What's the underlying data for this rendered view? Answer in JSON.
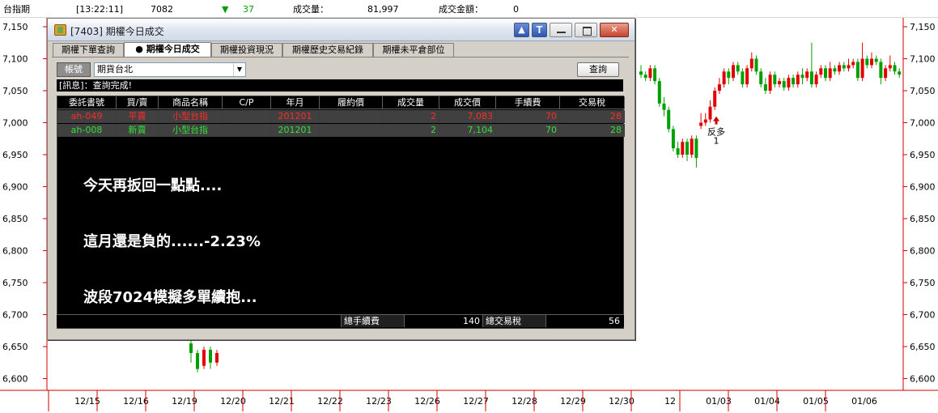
{
  "topbar": {
    "symbol": "台指期",
    "time": "[13:22:11]",
    "price": "7082",
    "change_arrow": "▼",
    "change": "37",
    "volume_label": "成交量：",
    "volume": "81,997",
    "amount_label": "成交金額：",
    "amount": "0",
    "down_color": "#00a000"
  },
  "window": {
    "title": "[7403] 期權今日成交",
    "tabs": [
      "期權下單查詢",
      "● 期權今日成交",
      "期權投資現況",
      "期權歷史交易紀錄",
      "期權未平倉部位"
    ],
    "active_tab": 1,
    "account_label": "帳號",
    "account_value": "期貨台北",
    "query_button": "查詢",
    "message": "[訊息]：查詢完成!",
    "columns": [
      "委託書號",
      "買/賣",
      "商品名稱",
      "C/P",
      "年月",
      "履約價",
      "成交量",
      "成交價",
      "手續費",
      "交易稅"
    ],
    "rows": [
      [
        "ah-049",
        "平賣",
        "小型台指",
        "",
        "201201",
        "",
        "2",
        "7,083",
        "70",
        "28"
      ],
      [
        "ah-008",
        "新賣",
        "小型台指",
        "",
        "201201",
        "",
        "2",
        "7,104",
        "70",
        "28"
      ]
    ],
    "row_colors": [
      "#ff2a2a",
      "#35e035"
    ],
    "notes": [
      "今天再扳回一點點....",
      "這月還是負的......-2.23%",
      "波段7024模擬多單續抱..."
    ],
    "footer": {
      "fee_label": "總手續費",
      "fee_value": "140",
      "tax_label": "總交易稅",
      "tax_value": "56"
    },
    "icons": [
      "app-icon",
      "top-icon",
      "t-icon",
      "minimize-icon",
      "maximize-icon",
      "close-icon",
      "dropdown-arrow-icon"
    ]
  },
  "chart_data": {
    "type": "candlestick",
    "y_ticks": [
      "7,150",
      "7,100",
      "7,050",
      "7,000",
      "6,950",
      "6,900",
      "6,850",
      "6,800",
      "6,750",
      "6,700",
      "6,650",
      "6,600"
    ],
    "ylim": [
      6580,
      7170
    ],
    "x_ticks": [
      "12/15",
      "12/16",
      "12/19",
      "12/20",
      "12/21",
      "12/22",
      "12/23",
      "12/26",
      "12/27",
      "12/28",
      "12/29",
      "12/30",
      "12",
      "01/03",
      "01/04",
      "01/05",
      "01/06"
    ],
    "up_color": "#e00000",
    "down_color": "#00a000",
    "annotation": {
      "text": "反多",
      "count": "1",
      "value": 7010
    },
    "candles": [
      [
        6655,
        6640,
        6660,
        6625
      ],
      [
        6640,
        6615,
        6645,
        6610
      ],
      [
        6620,
        6645,
        6650,
        6615
      ],
      [
        6645,
        6625,
        6650,
        6615
      ],
      [
        6625,
        6640,
        6645,
        6620
      ],
      [
        7080,
        7075,
        7090,
        7070
      ],
      [
        7075,
        7070,
        7080,
        7065
      ],
      [
        7070,
        7085,
        7090,
        7065
      ],
      [
        7085,
        7065,
        7090,
        7060
      ],
      [
        7065,
        7030,
        7070,
        7025
      ],
      [
        7030,
        7020,
        7040,
        7010
      ],
      [
        7020,
        6990,
        7025,
        6985
      ],
      [
        6990,
        6960,
        6995,
        6955
      ],
      [
        6960,
        6950,
        6970,
        6945
      ],
      [
        6950,
        6970,
        6975,
        6945
      ],
      [
        6970,
        6950,
        6975,
        6940
      ],
      [
        6950,
        6975,
        6980,
        6945
      ],
      [
        6975,
        6945,
        6980,
        6930
      ],
      [
        6995,
        7000,
        7015,
        6990
      ],
      [
        7000,
        7005,
        7015,
        6995
      ],
      [
        7005,
        7025,
        7035,
        7000
      ],
      [
        7025,
        7050,
        7055,
        7020
      ],
      [
        7050,
        7060,
        7070,
        7045
      ],
      [
        7060,
        7080,
        7085,
        7055
      ],
      [
        7080,
        7070,
        7085,
        7060
      ],
      [
        7070,
        7090,
        7095,
        7065
      ],
      [
        7090,
        7080,
        7095,
        7075
      ],
      [
        7080,
        7060,
        7085,
        7055
      ],
      [
        7060,
        7085,
        7090,
        7055
      ],
      [
        7085,
        7100,
        7110,
        7080
      ],
      [
        7100,
        7080,
        7105,
        7075
      ],
      [
        7080,
        7060,
        7085,
        7055
      ],
      [
        7060,
        7050,
        7070,
        7045
      ],
      [
        7050,
        7075,
        7080,
        7045
      ],
      [
        7075,
        7060,
        7080,
        7055
      ],
      [
        7060,
        7065,
        7070,
        7055
      ],
      [
        7065,
        7055,
        7070,
        7050
      ],
      [
        7055,
        7070,
        7075,
        7050
      ],
      [
        7070,
        7060,
        7075,
        7055
      ],
      [
        7060,
        7075,
        7080,
        7055
      ],
      [
        7075,
        7070,
        7085,
        7060
      ],
      [
        7070,
        7080,
        7085,
        7065
      ],
      [
        7080,
        7060,
        7125,
        7055
      ],
      [
        7060,
        7075,
        7080,
        7055
      ],
      [
        7075,
        7085,
        7090,
        7070
      ],
      [
        7085,
        7070,
        7090,
        7065
      ],
      [
        7070,
        7085,
        7095,
        7065
      ],
      [
        7085,
        7080,
        7090,
        7075
      ],
      [
        7080,
        7090,
        7095,
        7075
      ],
      [
        7090,
        7085,
        7095,
        7080
      ],
      [
        7085,
        7090,
        7100,
        7080
      ],
      [
        7090,
        7095,
        7100,
        7085
      ],
      [
        7095,
        7070,
        7100,
        7065
      ],
      [
        7070,
        7100,
        7125,
        7065
      ],
      [
        7100,
        7090,
        7105,
        7085
      ],
      [
        7090,
        7100,
        7110,
        7085
      ],
      [
        7100,
        7095,
        7105,
        7090
      ],
      [
        7095,
        7070,
        7100,
        7060
      ],
      [
        7070,
        7085,
        7090,
        7065
      ],
      [
        7085,
        7090,
        7105,
        7080
      ],
      [
        7090,
        7080,
        7095,
        7075
      ],
      [
        7080,
        7075,
        7085,
        7070
      ]
    ]
  }
}
